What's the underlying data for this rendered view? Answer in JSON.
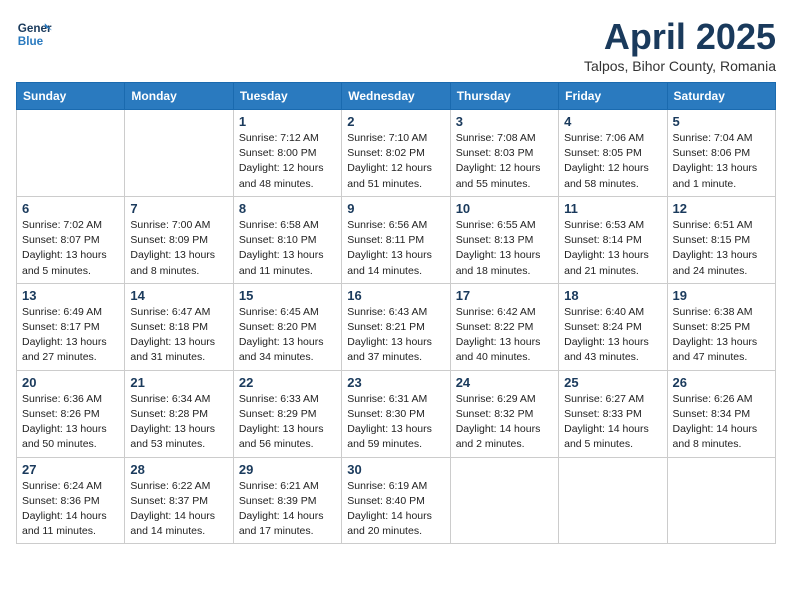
{
  "header": {
    "logo_line1": "General",
    "logo_line2": "Blue",
    "month_title": "April 2025",
    "location": "Talpos, Bihor County, Romania"
  },
  "weekdays": [
    "Sunday",
    "Monday",
    "Tuesday",
    "Wednesday",
    "Thursday",
    "Friday",
    "Saturday"
  ],
  "weeks": [
    [
      {
        "day": "",
        "info": ""
      },
      {
        "day": "",
        "info": ""
      },
      {
        "day": "1",
        "info": "Sunrise: 7:12 AM\nSunset: 8:00 PM\nDaylight: 12 hours and 48 minutes."
      },
      {
        "day": "2",
        "info": "Sunrise: 7:10 AM\nSunset: 8:02 PM\nDaylight: 12 hours and 51 minutes."
      },
      {
        "day": "3",
        "info": "Sunrise: 7:08 AM\nSunset: 8:03 PM\nDaylight: 12 hours and 55 minutes."
      },
      {
        "day": "4",
        "info": "Sunrise: 7:06 AM\nSunset: 8:05 PM\nDaylight: 12 hours and 58 minutes."
      },
      {
        "day": "5",
        "info": "Sunrise: 7:04 AM\nSunset: 8:06 PM\nDaylight: 13 hours and 1 minute."
      }
    ],
    [
      {
        "day": "6",
        "info": "Sunrise: 7:02 AM\nSunset: 8:07 PM\nDaylight: 13 hours and 5 minutes."
      },
      {
        "day": "7",
        "info": "Sunrise: 7:00 AM\nSunset: 8:09 PM\nDaylight: 13 hours and 8 minutes."
      },
      {
        "day": "8",
        "info": "Sunrise: 6:58 AM\nSunset: 8:10 PM\nDaylight: 13 hours and 11 minutes."
      },
      {
        "day": "9",
        "info": "Sunrise: 6:56 AM\nSunset: 8:11 PM\nDaylight: 13 hours and 14 minutes."
      },
      {
        "day": "10",
        "info": "Sunrise: 6:55 AM\nSunset: 8:13 PM\nDaylight: 13 hours and 18 minutes."
      },
      {
        "day": "11",
        "info": "Sunrise: 6:53 AM\nSunset: 8:14 PM\nDaylight: 13 hours and 21 minutes."
      },
      {
        "day": "12",
        "info": "Sunrise: 6:51 AM\nSunset: 8:15 PM\nDaylight: 13 hours and 24 minutes."
      }
    ],
    [
      {
        "day": "13",
        "info": "Sunrise: 6:49 AM\nSunset: 8:17 PM\nDaylight: 13 hours and 27 minutes."
      },
      {
        "day": "14",
        "info": "Sunrise: 6:47 AM\nSunset: 8:18 PM\nDaylight: 13 hours and 31 minutes."
      },
      {
        "day": "15",
        "info": "Sunrise: 6:45 AM\nSunset: 8:20 PM\nDaylight: 13 hours and 34 minutes."
      },
      {
        "day": "16",
        "info": "Sunrise: 6:43 AM\nSunset: 8:21 PM\nDaylight: 13 hours and 37 minutes."
      },
      {
        "day": "17",
        "info": "Sunrise: 6:42 AM\nSunset: 8:22 PM\nDaylight: 13 hours and 40 minutes."
      },
      {
        "day": "18",
        "info": "Sunrise: 6:40 AM\nSunset: 8:24 PM\nDaylight: 13 hours and 43 minutes."
      },
      {
        "day": "19",
        "info": "Sunrise: 6:38 AM\nSunset: 8:25 PM\nDaylight: 13 hours and 47 minutes."
      }
    ],
    [
      {
        "day": "20",
        "info": "Sunrise: 6:36 AM\nSunset: 8:26 PM\nDaylight: 13 hours and 50 minutes."
      },
      {
        "day": "21",
        "info": "Sunrise: 6:34 AM\nSunset: 8:28 PM\nDaylight: 13 hours and 53 minutes."
      },
      {
        "day": "22",
        "info": "Sunrise: 6:33 AM\nSunset: 8:29 PM\nDaylight: 13 hours and 56 minutes."
      },
      {
        "day": "23",
        "info": "Sunrise: 6:31 AM\nSunset: 8:30 PM\nDaylight: 13 hours and 59 minutes."
      },
      {
        "day": "24",
        "info": "Sunrise: 6:29 AM\nSunset: 8:32 PM\nDaylight: 14 hours and 2 minutes."
      },
      {
        "day": "25",
        "info": "Sunrise: 6:27 AM\nSunset: 8:33 PM\nDaylight: 14 hours and 5 minutes."
      },
      {
        "day": "26",
        "info": "Sunrise: 6:26 AM\nSunset: 8:34 PM\nDaylight: 14 hours and 8 minutes."
      }
    ],
    [
      {
        "day": "27",
        "info": "Sunrise: 6:24 AM\nSunset: 8:36 PM\nDaylight: 14 hours and 11 minutes."
      },
      {
        "day": "28",
        "info": "Sunrise: 6:22 AM\nSunset: 8:37 PM\nDaylight: 14 hours and 14 minutes."
      },
      {
        "day": "29",
        "info": "Sunrise: 6:21 AM\nSunset: 8:39 PM\nDaylight: 14 hours and 17 minutes."
      },
      {
        "day": "30",
        "info": "Sunrise: 6:19 AM\nSunset: 8:40 PM\nDaylight: 14 hours and 20 minutes."
      },
      {
        "day": "",
        "info": ""
      },
      {
        "day": "",
        "info": ""
      },
      {
        "day": "",
        "info": ""
      }
    ]
  ]
}
